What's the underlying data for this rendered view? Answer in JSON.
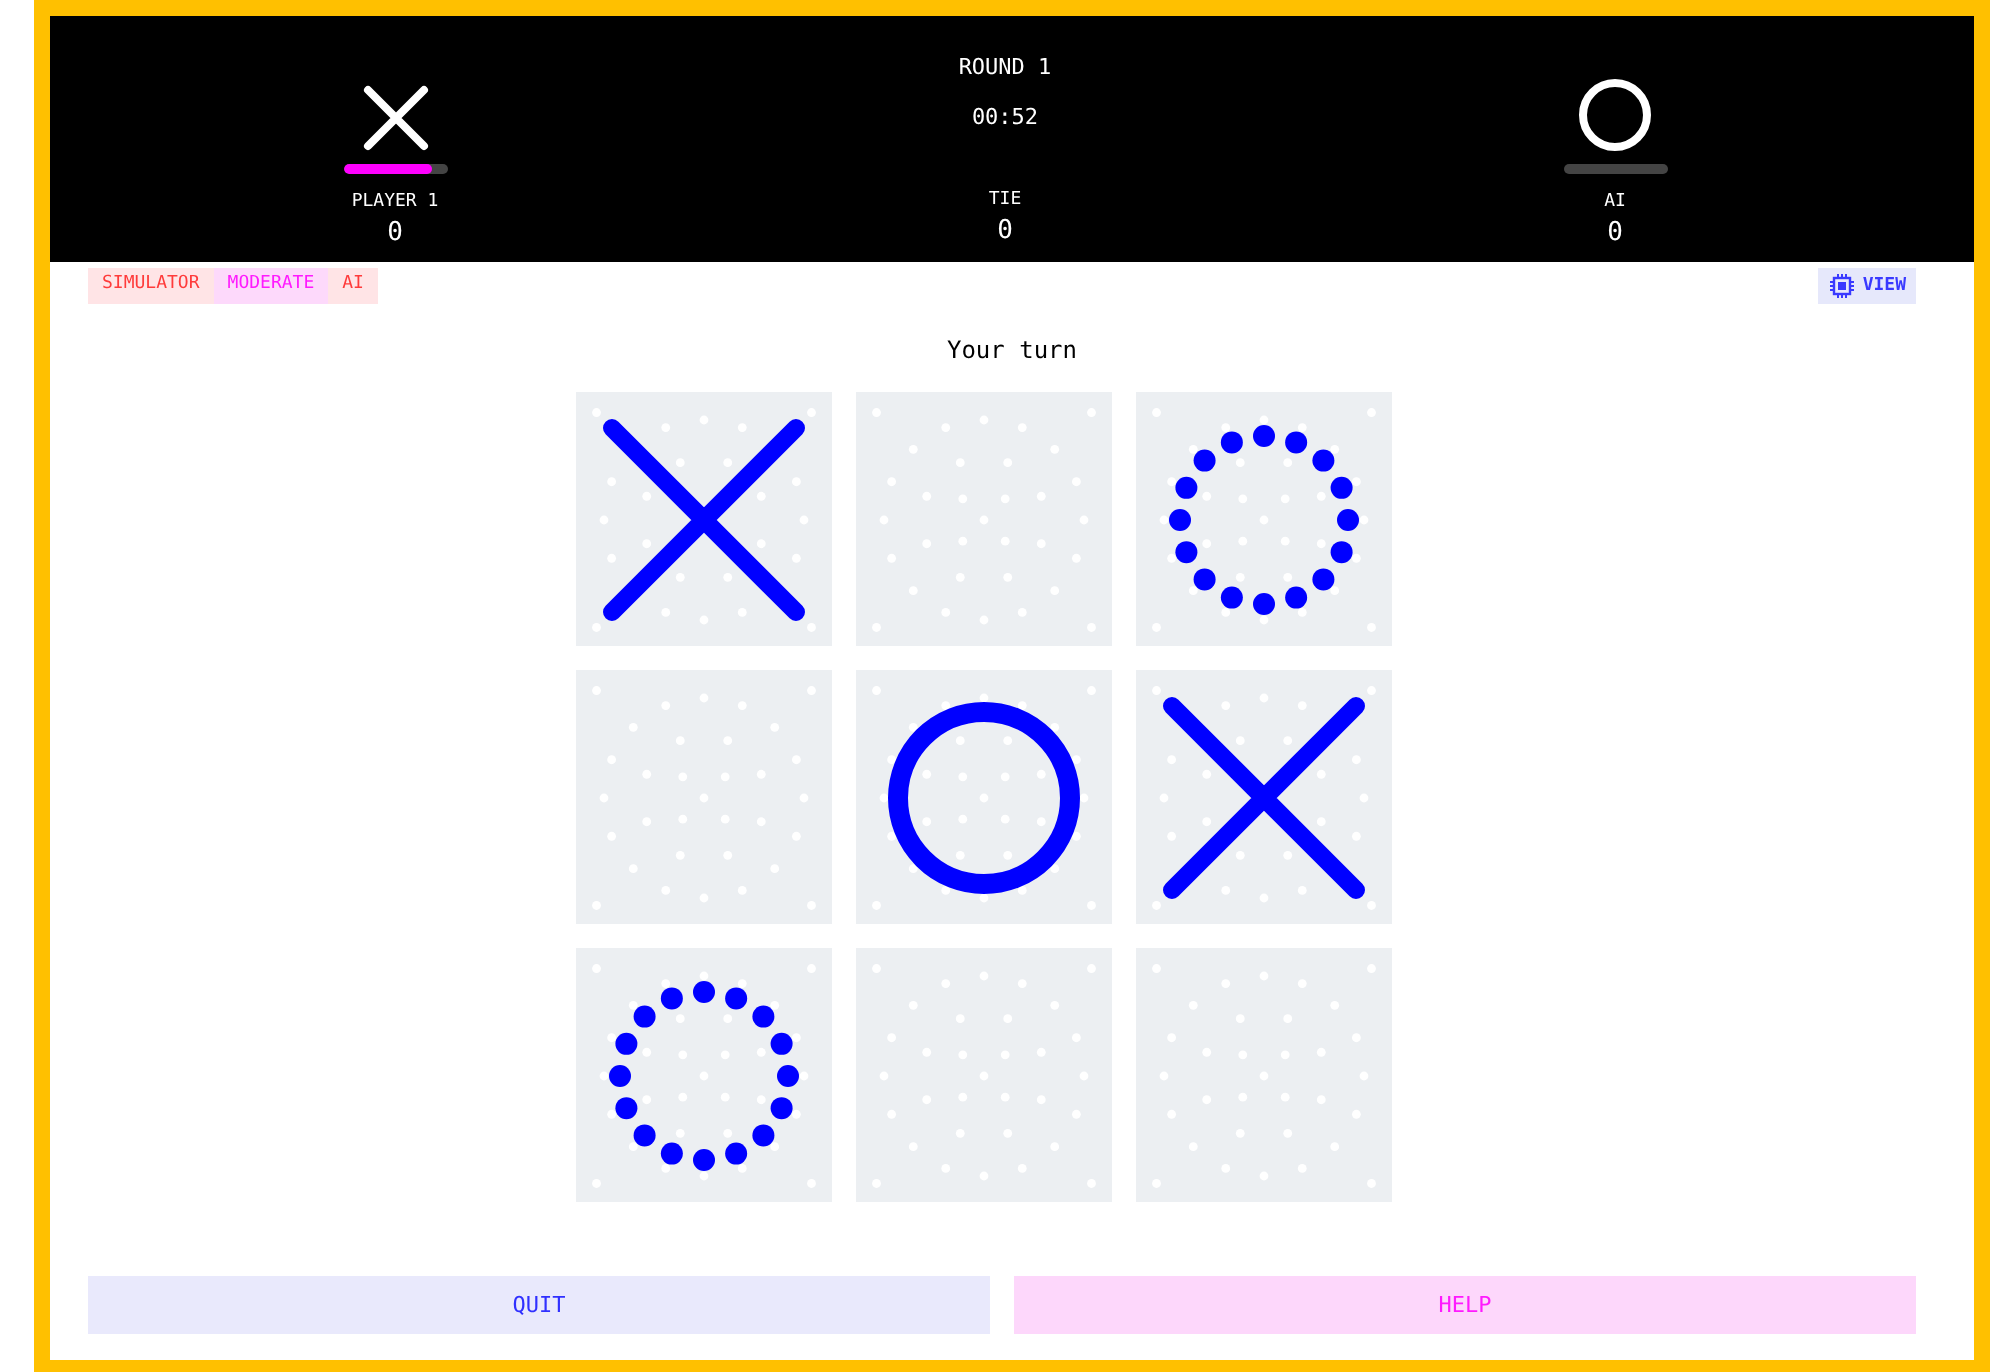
{
  "header": {
    "round": "ROUND 1",
    "timer": "00:52",
    "players": [
      {
        "name": "PLAYER 1",
        "score": "0",
        "kind": "x",
        "level": 0.85
      },
      {
        "name": "AI",
        "score": "0",
        "kind": "o",
        "level": 0
      }
    ],
    "tie": {
      "label": "TIE",
      "score": "0"
    }
  },
  "tags": [
    {
      "label": "SIMULATOR",
      "color": "#ff3b3b"
    },
    {
      "label": "MODERATE",
      "color": "#ff1aff"
    },
    {
      "label": "AI",
      "color": "#ff3b3b"
    }
  ],
  "view_button": {
    "label": "VIEW"
  },
  "status": "Your turn",
  "board": [
    {
      "kind": "x"
    },
    {
      "kind": "empty"
    },
    {
      "kind": "dotted-o"
    },
    {
      "kind": "empty"
    },
    {
      "kind": "o"
    },
    {
      "kind": "x"
    },
    {
      "kind": "dotted-o"
    },
    {
      "kind": "empty"
    },
    {
      "kind": "empty"
    }
  ],
  "buttons": [
    {
      "label": "QUIT",
      "kind": "quit"
    },
    {
      "label": "HELP",
      "kind": "help"
    }
  ]
}
